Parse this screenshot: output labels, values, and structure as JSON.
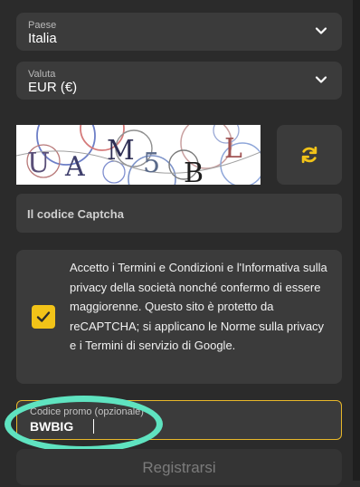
{
  "country": {
    "label": "Paese",
    "value": "Italia"
  },
  "currency": {
    "label": "Valuta",
    "value": "EUR (€)"
  },
  "captcha": {
    "letters": [
      "U",
      "A",
      "M",
      "5",
      "B",
      "L"
    ],
    "input_placeholder": "Il codice Captcha",
    "refresh_icon": "refresh-icon"
  },
  "terms": {
    "checked": true,
    "text": "Accetto i Termini e Condizioni e l'Informativa sulla privacy della società nonché confermo di essere maggiorenne. Questo sito è protetto da reCAPTCHA; si applicano le Norme sulla privacy e i Termini di servizio di Google."
  },
  "promo": {
    "label": "Codice promo (opzionale)",
    "value": "BWBIG"
  },
  "register": {
    "label": "Registrarsi"
  },
  "colors": {
    "accent": "#f2c318",
    "field_bg": "#3b3b3b",
    "page_bg": "#2b2b2b",
    "highlight": "#5fe3c0"
  }
}
